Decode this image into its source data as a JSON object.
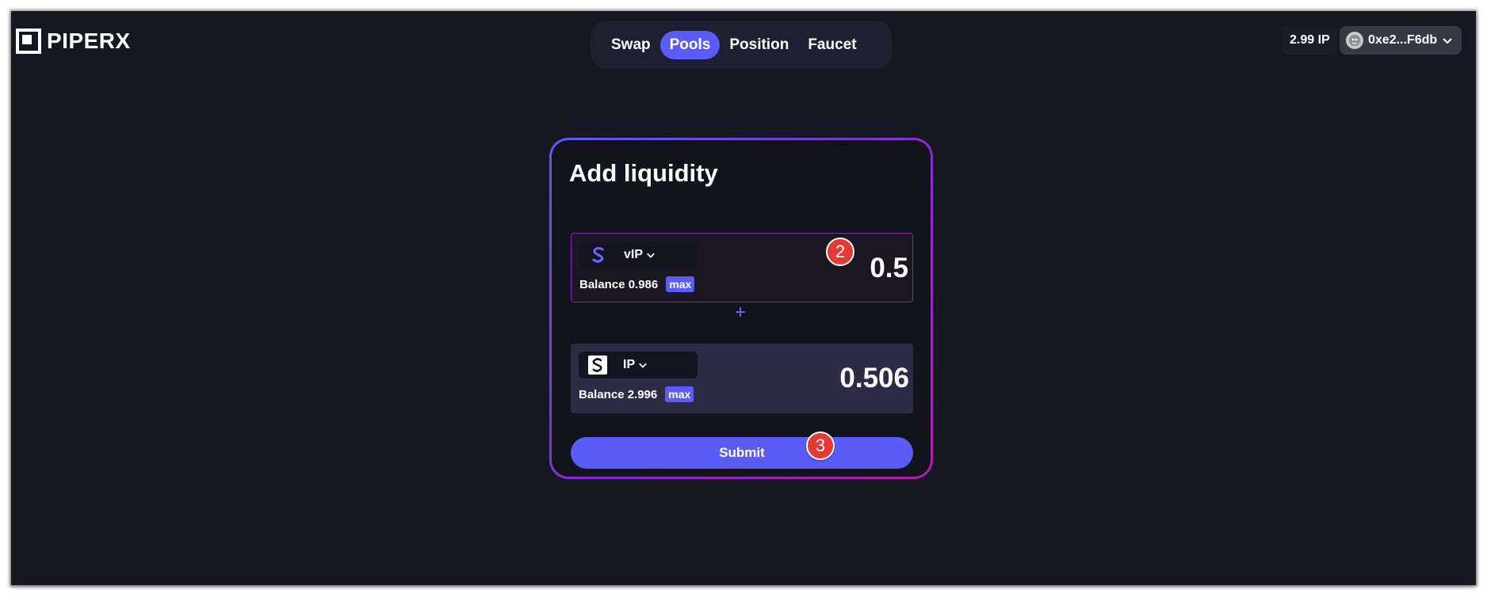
{
  "brand": {
    "name": "PIPERX"
  },
  "nav": {
    "items": [
      {
        "label": "Swap",
        "active": false
      },
      {
        "label": "Pools",
        "active": true
      },
      {
        "label": "Position",
        "active": false
      },
      {
        "label": "Faucet",
        "active": false
      }
    ]
  },
  "wallet": {
    "balance": "2.99 IP",
    "address": "0xe2...F6db",
    "avatar_icon": "avatar-icon",
    "dropdown_icon": "chevron-down-icon"
  },
  "card": {
    "title": "Add liquidity",
    "token_a": {
      "symbol": "vIP",
      "icon": "vip-token-icon",
      "balance_label": "Balance 0.986",
      "max_label": "max",
      "amount": "0.5"
    },
    "plus": "+",
    "token_b": {
      "symbol": "IP",
      "icon": "ip-token-icon",
      "balance_label": "Balance 2.996",
      "max_label": "max",
      "amount": "0.506"
    },
    "submit_label": "Submit"
  },
  "annotations": {
    "step_2": "2",
    "step_3": "3"
  },
  "colors": {
    "background": "#151823",
    "accent": "#5b5cf6",
    "card_border_gradient_end": "#b01ea8",
    "badge": "#e53935"
  }
}
